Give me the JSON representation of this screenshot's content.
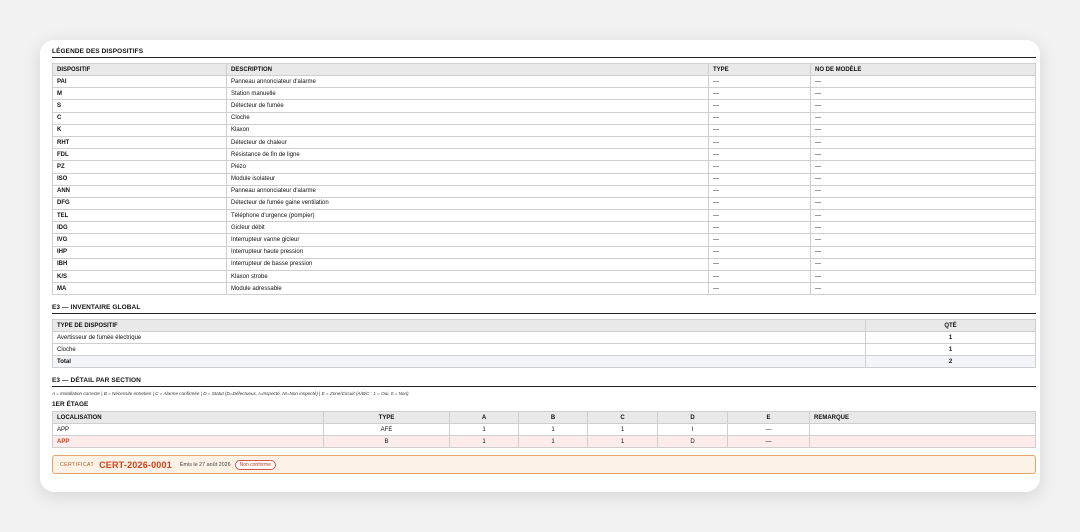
{
  "legend": {
    "title": "LÉGENDE DES DISPOSITIFS",
    "headers": [
      "DISPOSITIF",
      "DESCRIPTION",
      "TYPE",
      "NO DE MODÈLE"
    ],
    "rows": [
      {
        "code": "PAI",
        "desc": "Panneau annonciateur d'alarme",
        "type": "—",
        "model": "—"
      },
      {
        "code": "M",
        "desc": "Station manuelle",
        "type": "—",
        "model": "—"
      },
      {
        "code": "S",
        "desc": "Détecteur de fumée",
        "type": "—",
        "model": "—"
      },
      {
        "code": "C",
        "desc": "Cloche",
        "type": "—",
        "model": "—"
      },
      {
        "code": "K",
        "desc": "Klaxon",
        "type": "—",
        "model": "—"
      },
      {
        "code": "RHT",
        "desc": "Détecteur de chaleur",
        "type": "—",
        "model": "—"
      },
      {
        "code": "FDL",
        "desc": "Résistance de fin de ligne",
        "type": "—",
        "model": "—"
      },
      {
        "code": "PZ",
        "desc": "Piézo",
        "type": "—",
        "model": "—"
      },
      {
        "code": "ISO",
        "desc": "Module isolateur",
        "type": "—",
        "model": "—"
      },
      {
        "code": "ANN",
        "desc": "Panneau annonciateur d'alarme",
        "type": "—",
        "model": "—"
      },
      {
        "code": "DFG",
        "desc": "Détecteur de fumée gaine ventilation",
        "type": "—",
        "model": "—"
      },
      {
        "code": "TEL",
        "desc": "Téléphone d'urgence (pompier)",
        "type": "—",
        "model": "—"
      },
      {
        "code": "IDG",
        "desc": "Gicleur débit",
        "type": "—",
        "model": "—"
      },
      {
        "code": "IVG",
        "desc": "Interrupteur vanne gicleur",
        "type": "—",
        "model": "—"
      },
      {
        "code": "IHP",
        "desc": "Interrupteur haute pression",
        "type": "—",
        "model": "—"
      },
      {
        "code": "IBH",
        "desc": "Interrupteur de basse pression",
        "type": "—",
        "model": "—"
      },
      {
        "code": "K/S",
        "desc": "Klaxon strobe",
        "type": "—",
        "model": "—"
      },
      {
        "code": "MA",
        "desc": "Module adressable",
        "type": "—",
        "model": "—"
      }
    ]
  },
  "inventory": {
    "title": "E3 — INVENTAIRE GLOBAL",
    "headers": [
      "TYPE DE DISPOSITIF",
      "QTÉ"
    ],
    "rows": [
      {
        "type": "Avertisseur de fumée électrique",
        "qty": "1"
      },
      {
        "type": "Cloche",
        "qty": "1"
      }
    ],
    "total_label": "Total",
    "total_qty": "2"
  },
  "detail": {
    "title": "E3 — DÉTAIL PAR SECTION",
    "legend_text": "A = Installation correcte  |  B = Nécessite entretien  |  C = Alarme confirmée  |  D = Statut (D=Défectueux, I=Inspecté, NI=Non inspecté)  |  E = Zone/Circuit   (A/B/C : 1 = Oui, 0 = Non)",
    "floor": "1ER ÉTAGE",
    "headers": [
      "LOCALISATION",
      "TYPE",
      "A",
      "B",
      "C",
      "D",
      "E",
      "REMARQUE"
    ],
    "rows": [
      {
        "loc": "APP",
        "type": "AFE",
        "a": "1",
        "b": "1",
        "c": "1",
        "d": "I",
        "e": "—",
        "rem": ""
      },
      {
        "loc": "APP",
        "type": "B",
        "a": "1",
        "b": "1",
        "c": "1",
        "d": "D",
        "e": "—",
        "rem": ""
      }
    ]
  },
  "certificate": {
    "label": "CERTIFICAT",
    "number": "CERT-2026-0001",
    "issued": "Émis le 27 août 2026",
    "status": "Non conforme"
  }
}
